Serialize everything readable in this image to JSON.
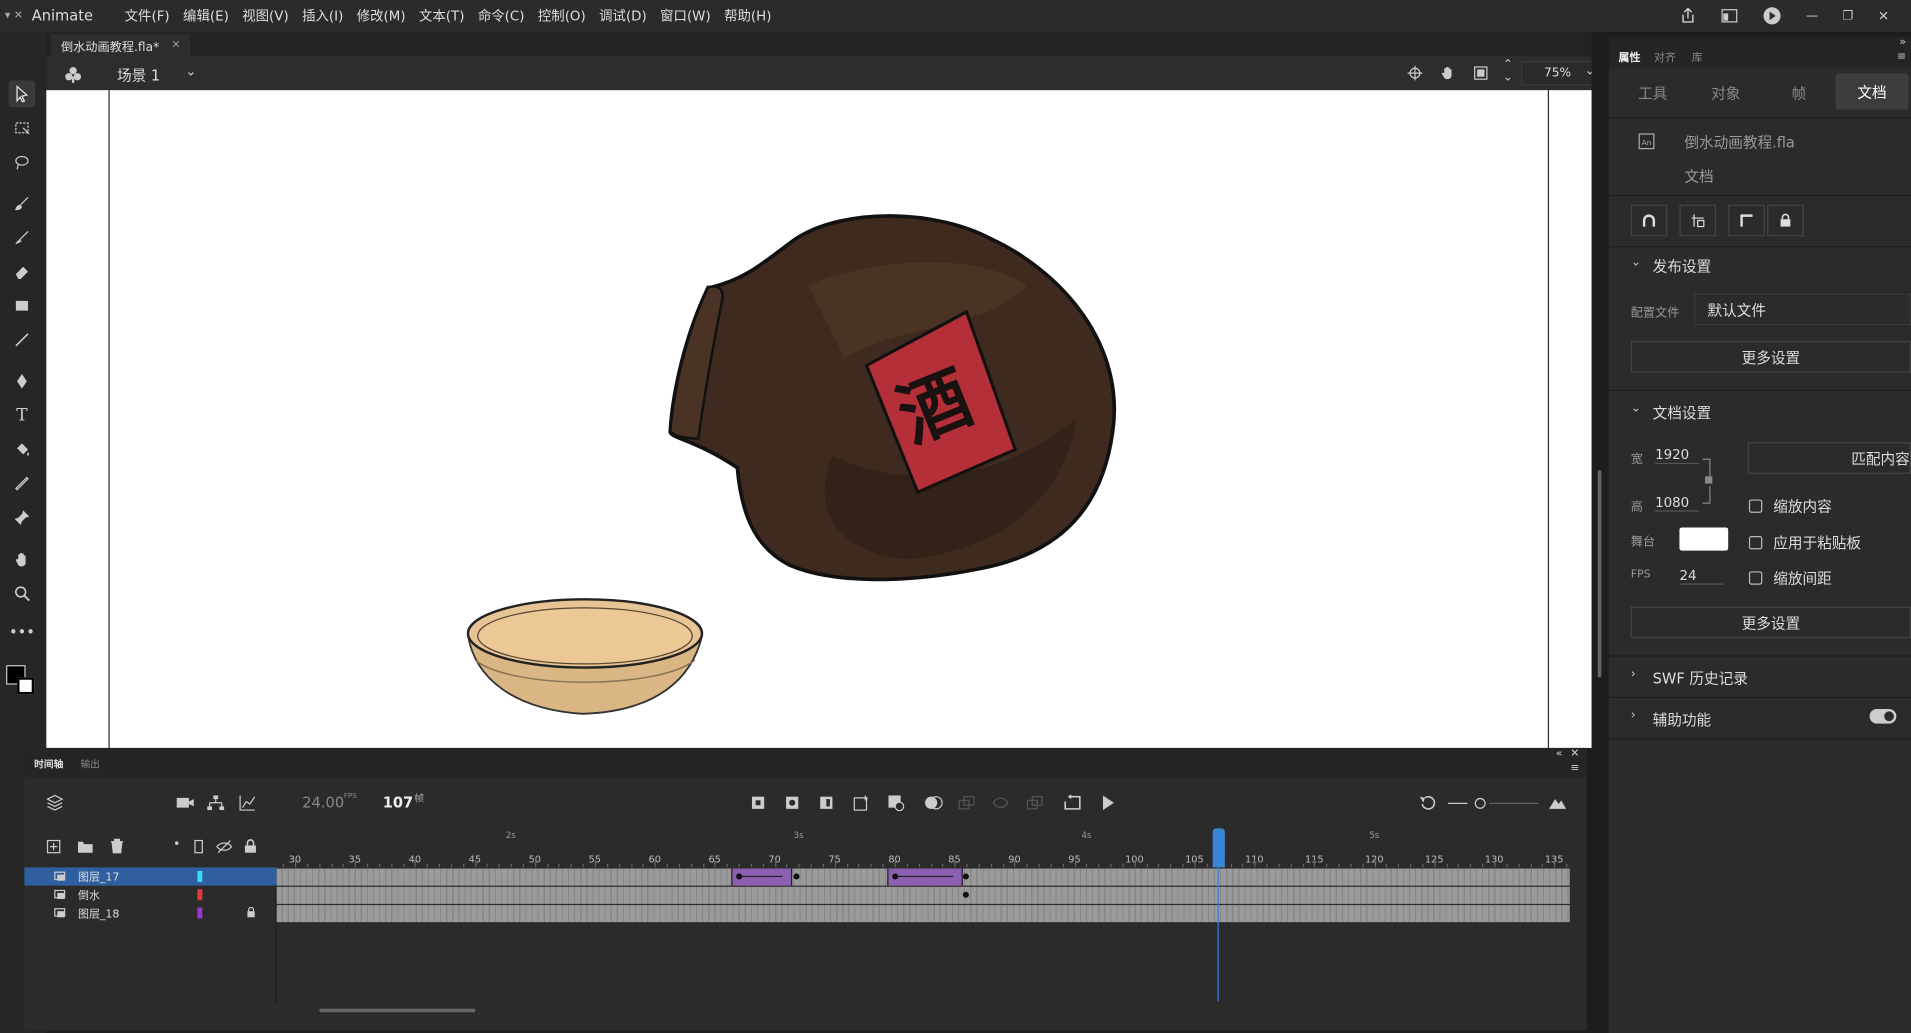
{
  "menubar": {
    "app_name": "Animate",
    "items": [
      "文件(F)",
      "编辑(E)",
      "视图(V)",
      "插入(I)",
      "修改(M)",
      "文本(T)",
      "命令(C)",
      "控制(O)",
      "调试(D)",
      "窗口(W)",
      "帮助(H)"
    ]
  },
  "document": {
    "tab_label": "倒水动画教程.fla*",
    "scene_label": "场景 1",
    "zoom": "75%"
  },
  "timeline": {
    "tabs": [
      "时间轴",
      "输出"
    ],
    "fps": "24.00",
    "fps_unit": "FPS",
    "current_frame": "107",
    "frame_unit": "帧",
    "ruler_labels": [
      "30",
      "35",
      "40",
      "45",
      "50",
      "55",
      "60",
      "65",
      "70",
      "75",
      "80",
      "85",
      "90",
      "95",
      "100",
      "105",
      "110",
      "115",
      "120",
      "125",
      "130",
      "135"
    ],
    "second_labels": [
      "2s",
      "3s",
      "4s",
      "5s"
    ],
    "layers": [
      {
        "name": "图层_17",
        "color": "#33e0f0",
        "selected": true,
        "locked": false
      },
      {
        "name": "倒水",
        "color": "#e03a3a",
        "selected": false,
        "locked": false
      },
      {
        "name": "图层_18",
        "color": "#9a36d0",
        "selected": false,
        "locked": true
      }
    ]
  },
  "properties": {
    "panel_tabs": [
      "属性",
      "对齐",
      "库"
    ],
    "mode_tabs": [
      "工具",
      "对象",
      "帧",
      "文档"
    ],
    "file_name": "倒水动画教程.fla",
    "file_type": "文档",
    "publish": {
      "title": "发布设置",
      "profile_label": "配置文件",
      "profile_value": "默认文件",
      "more_button": "更多设置"
    },
    "doc_settings": {
      "title": "文档设置",
      "width_label": "宽",
      "width_value": "1920",
      "height_label": "高",
      "height_value": "1080",
      "stage_label": "舞台",
      "stage_color": "#ffffff",
      "fps_label": "FPS",
      "fps_value": "24",
      "match_button": "匹配内容",
      "checks": [
        "缩放内容",
        "应用于粘贴板",
        "缩放间距"
      ],
      "more_button": "更多设置"
    },
    "swf_history": "SWF 历史记录",
    "accessibility": "辅助功能"
  },
  "stage": {
    "label_char": "酒"
  }
}
